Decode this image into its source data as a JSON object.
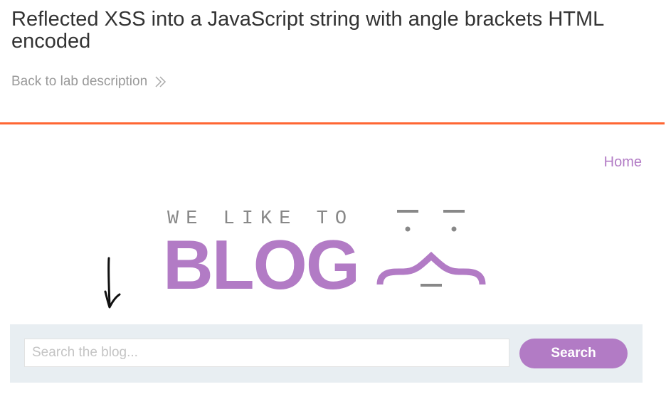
{
  "lab": {
    "title": "Reflected XSS into a JavaScript string with angle brackets HTML encoded",
    "back_link_label": "Back to lab description",
    "back_link_icon": "double-chevron-right-icon"
  },
  "colors": {
    "accent_orange": "#ff6633",
    "brand_purple": "#b27bc5",
    "logo_gray": "#888888",
    "search_panel_bg": "#e8eef2"
  },
  "nav": {
    "home_label": "Home"
  },
  "logo": {
    "tagline": "WE LIKE TO",
    "wordmark": "BLOG"
  },
  "search": {
    "placeholder": "Search the blog...",
    "value": "",
    "button_label": "Search"
  }
}
